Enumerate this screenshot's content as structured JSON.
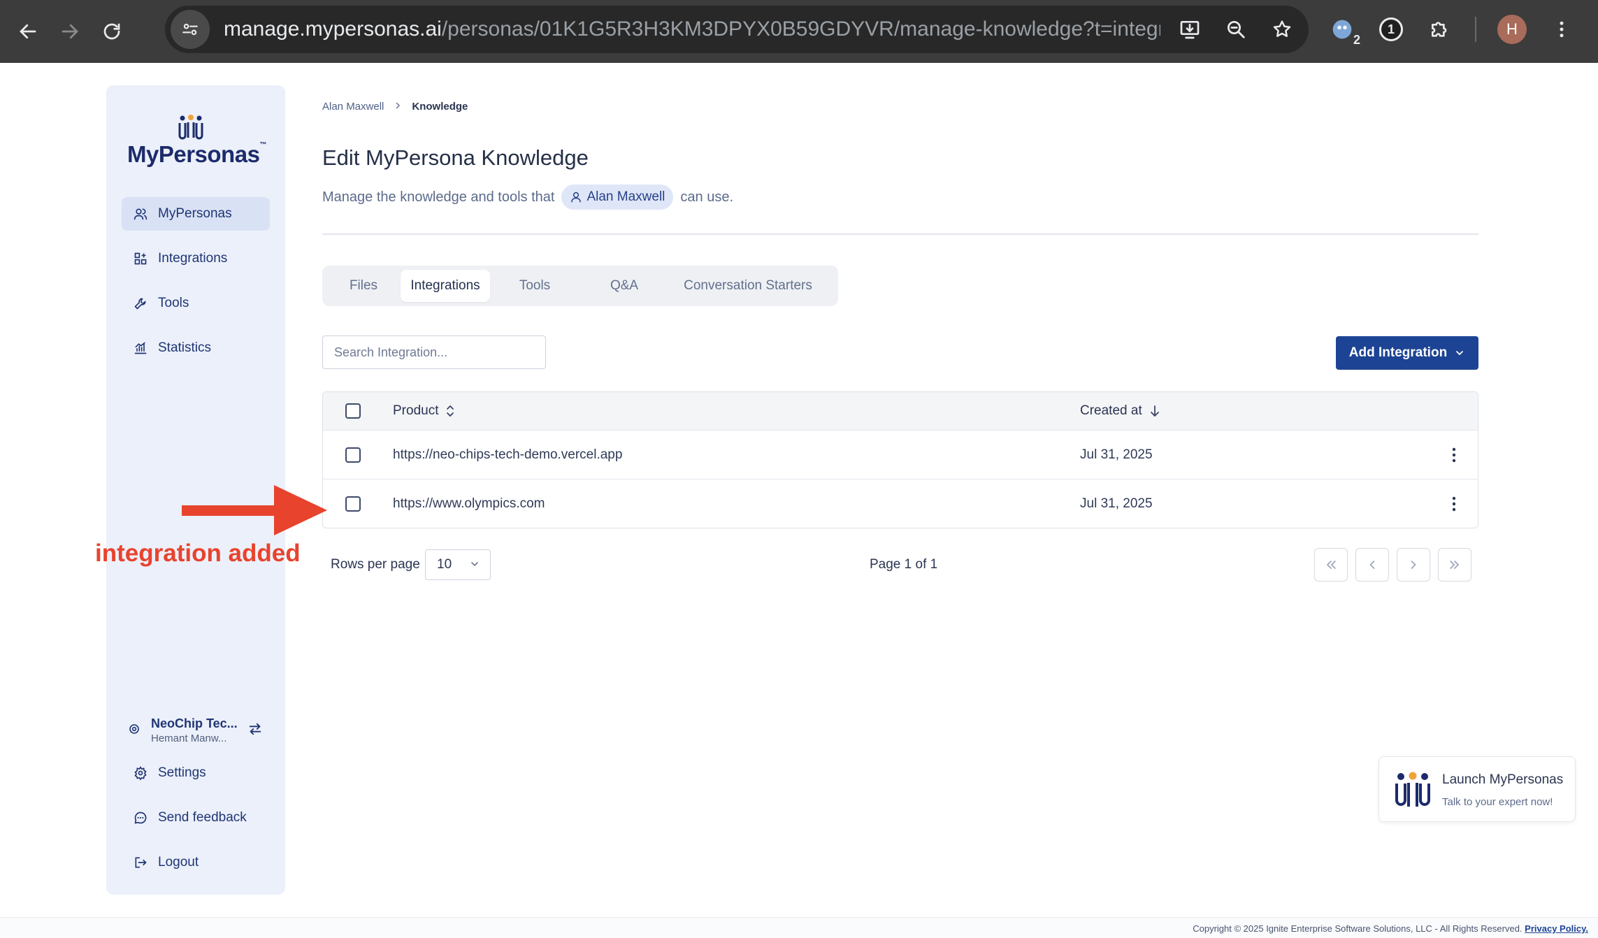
{
  "browser": {
    "url_host": "manage.mypersonas.ai",
    "url_path": "/personas/01K1G5R3H3KM3DPYX0B59GDYVR/manage-knowledge?t=integr…",
    "extension_badge": "2",
    "extension_one": "1",
    "profile_initial": "H"
  },
  "sidebar": {
    "logo_text": "MyPersonas",
    "logo_tm": "™",
    "items": [
      {
        "label": "MyPersonas",
        "icon": "users-icon",
        "active": true
      },
      {
        "label": "Integrations",
        "icon": "integrations-icon",
        "active": false
      },
      {
        "label": "Tools",
        "icon": "wrench-icon",
        "active": false
      },
      {
        "label": "Statistics",
        "icon": "chart-icon",
        "active": false
      }
    ],
    "org_name": "NeoChip Tec...",
    "org_user": "Hemant Manw...",
    "bottom_items": [
      {
        "label": "Settings",
        "icon": "gear-icon"
      },
      {
        "label": "Send feedback",
        "icon": "chat-icon"
      },
      {
        "label": "Logout",
        "icon": "logout-icon"
      }
    ]
  },
  "breadcrumb": {
    "parent": "Alan Maxwell",
    "current": "Knowledge"
  },
  "page": {
    "title": "Edit MyPersona Knowledge",
    "subtitle_before": "Manage the knowledge and tools that",
    "persona_name": "Alan Maxwell",
    "subtitle_after": "can use."
  },
  "tabs": [
    {
      "label": "Files",
      "active": false
    },
    {
      "label": "Integrations",
      "active": true
    },
    {
      "label": "Tools",
      "active": false
    },
    {
      "label": "Q&A",
      "active": false
    },
    {
      "label": "Conversation Starters",
      "active": false
    }
  ],
  "search": {
    "placeholder": "Search Integration..."
  },
  "add_button": {
    "label": "Add Integration"
  },
  "table": {
    "columns": {
      "product": "Product",
      "created": "Created at"
    },
    "rows": [
      {
        "product": "https://neo-chips-tech-demo.vercel.app",
        "created": "Jul 31, 2025"
      },
      {
        "product": "https://www.olympics.com",
        "created": "Jul 31, 2025"
      }
    ]
  },
  "pagination": {
    "rows_label": "Rows per page",
    "rows_value": "10",
    "page_info": "Page 1 of 1"
  },
  "annotation": {
    "label": "integration added",
    "color": "#e8432d"
  },
  "launch_widget": {
    "title": "Launch MyPersonas",
    "subtitle": "Talk to your expert now!"
  },
  "footer": {
    "copyright": "Copyright © 2025 Ignite Enterprise Software Solutions, LLC - All Rights Reserved.",
    "privacy": "Privacy Policy."
  },
  "colors": {
    "primary": "#1d4494",
    "sidebar_bg": "#ecf0fa",
    "accent_red": "#e8432d"
  }
}
